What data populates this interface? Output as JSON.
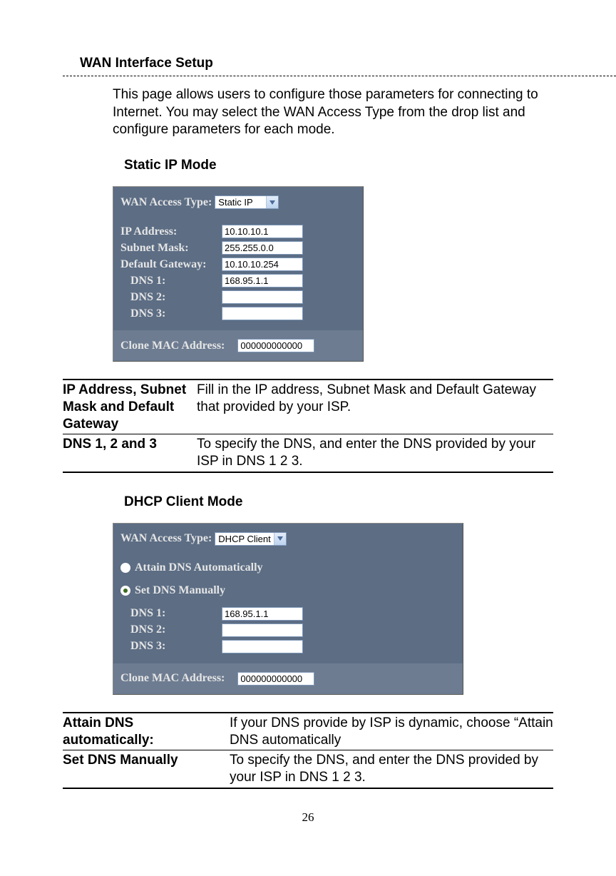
{
  "page_number": "26",
  "title": "WAN Interface Setup",
  "intro": "This page allows users to configure those parameters for connecting to Internet. You may select the WAN Access Type from the drop list and configure parameters for each mode.",
  "static": {
    "heading": "Static IP Mode",
    "wan_label": "WAN Access Type: ",
    "wan_value": "Static IP",
    "ip_label": "IP Address:",
    "ip_value": "10.10.10.1",
    "mask_label": "Subnet Mask:",
    "mask_value": "255.255.0.0",
    "gw_label": "Default Gateway:",
    "gw_value": "10.10.10.254",
    "dns1_label": "DNS 1:",
    "dns1_value": "168.95.1.1",
    "dns2_label": "DNS 2:",
    "dns2_value": "",
    "dns3_label": "DNS 3:",
    "dns3_value": "",
    "mac_label": "Clone MAC Address:",
    "mac_value": "000000000000",
    "table": {
      "r1k": "IP Address, Subnet Mask and Default Gateway",
      "r1v": "Fill in the IP address, Subnet Mask and Default Gateway that provided by your ISP.",
      "r2k": "DNS 1, 2 and 3",
      "r2v": "To specify the DNS, and enter the DNS provided by your ISP in DNS 1 2 3."
    }
  },
  "dhcp": {
    "heading": "DHCP Client Mode",
    "wan_label": "WAN Access Type: ",
    "wan_value": "DHCP Client",
    "opt_auto": "Attain DNS Automatically",
    "opt_manual": "Set DNS Manually",
    "dns1_label": "DNS 1:",
    "dns1_value": "168.95.1.1",
    "dns2_label": "DNS 2:",
    "dns2_value": "",
    "dns3_label": "DNS 3:",
    "dns3_value": "",
    "mac_label": "Clone MAC Address:",
    "mac_value": "000000000000",
    "table": {
      "r1k": "Attain DNS automatically:",
      "r1v": "If your DNS provide by ISP is dynamic, choose “Attain DNS automatically",
      "r2k": "Set DNS Manually",
      "r2v": "To specify the DNS, and enter the DNS provided by your ISP in DNS 1 2 3."
    }
  }
}
